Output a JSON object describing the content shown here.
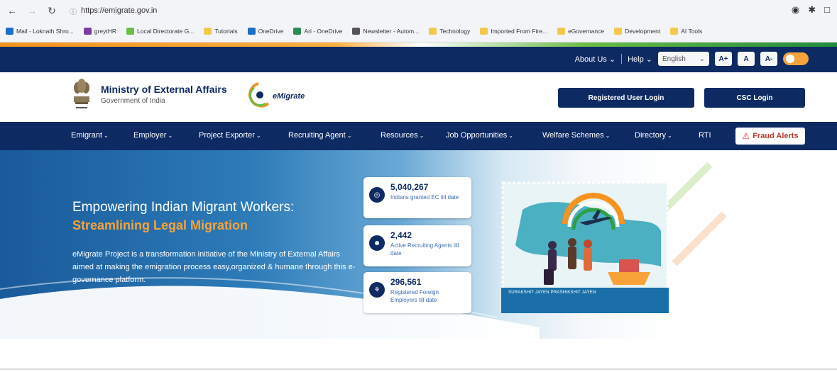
{
  "browser": {
    "url": "https://emigrate.gov.in",
    "bookmarks": [
      {
        "label": "Mail - Loknath Shro...",
        "icon": "outlook-icon",
        "color": "#1f6fc5"
      },
      {
        "label": "greytHR",
        "icon": "greythr-icon",
        "color": "#7b3fa0"
      },
      {
        "label": "Local Directorate G...",
        "icon": "directorate-icon",
        "color": "#6abd45"
      },
      {
        "label": "Tutorials",
        "icon": "folder-icon",
        "color": "#f2c94c"
      },
      {
        "label": "OneDrive",
        "icon": "onedrive-icon",
        "color": "#1f6fc5"
      },
      {
        "label": "Ari - OneDrive",
        "icon": "onedrive-icon",
        "color": "#2e8b57"
      },
      {
        "label": "Newsletter - Autom...",
        "icon": "newsletter-icon",
        "color": "#555555"
      },
      {
        "label": "Technology",
        "icon": "folder-icon",
        "color": "#f2c94c"
      },
      {
        "label": "Imported From Fire...",
        "icon": "folder-icon",
        "color": "#f2c94c"
      },
      {
        "label": "eGovernance",
        "icon": "folder-icon",
        "color": "#f2c94c"
      },
      {
        "label": "Development",
        "icon": "folder-icon",
        "color": "#f2c94c"
      },
      {
        "label": "AI Tools",
        "icon": "folder-icon",
        "color": "#f2c94c"
      }
    ]
  },
  "utility": {
    "about": "About Us",
    "help": "Help",
    "language": "English",
    "font_increase": "A+",
    "font_normal": "A",
    "font_decrease": "A-"
  },
  "header": {
    "ministry_title": "Ministry of External Affairs",
    "ministry_subtitle": "Government of India",
    "logo_text": "eMigrate",
    "login_button": "Registered User Login",
    "csc_button": "CSC Login"
  },
  "nav": {
    "items": [
      {
        "label": "Emigrant",
        "has_caret": true
      },
      {
        "label": "Employer",
        "has_caret": true
      },
      {
        "label": "Project Exporter",
        "has_caret": true
      },
      {
        "label": "Recruiting Agent",
        "has_caret": true
      },
      {
        "label": "Resources",
        "has_caret": true
      },
      {
        "label": "Job Opportunities",
        "has_caret": true
      },
      {
        "label": "Welfare Schemes",
        "has_caret": true
      },
      {
        "label": "Directory",
        "has_caret": true
      },
      {
        "label": "RTI",
        "has_caret": false
      }
    ],
    "fraud_alerts": "Fraud Alerts"
  },
  "hero": {
    "heading": "Empowering Indian Migrant Workers:",
    "subheading": "Streamlining Legal Migration",
    "description": "eMigrate Project is a transformation initiative of the Ministry of External Affairs aimed at making the emigration process easy,organized & humane through this e-governance platform.",
    "stamp_caption": "SURAKSHIT JAYEN PRASHIKSHIT JAYEN"
  },
  "stats": [
    {
      "value": "5,040,267",
      "label": "Indians granted EC till date",
      "icon": "globe-icon"
    },
    {
      "value": "2,442",
      "label": "Active Recruiting Agents till date",
      "icon": "agents-icon"
    },
    {
      "value": "296,561",
      "label": "Registered Foreign Employers till date",
      "icon": "employer-icon"
    }
  ],
  "colors": {
    "navy": "#0e2a63",
    "saffron": "#f7a33a",
    "alert_red": "#d62d20"
  }
}
